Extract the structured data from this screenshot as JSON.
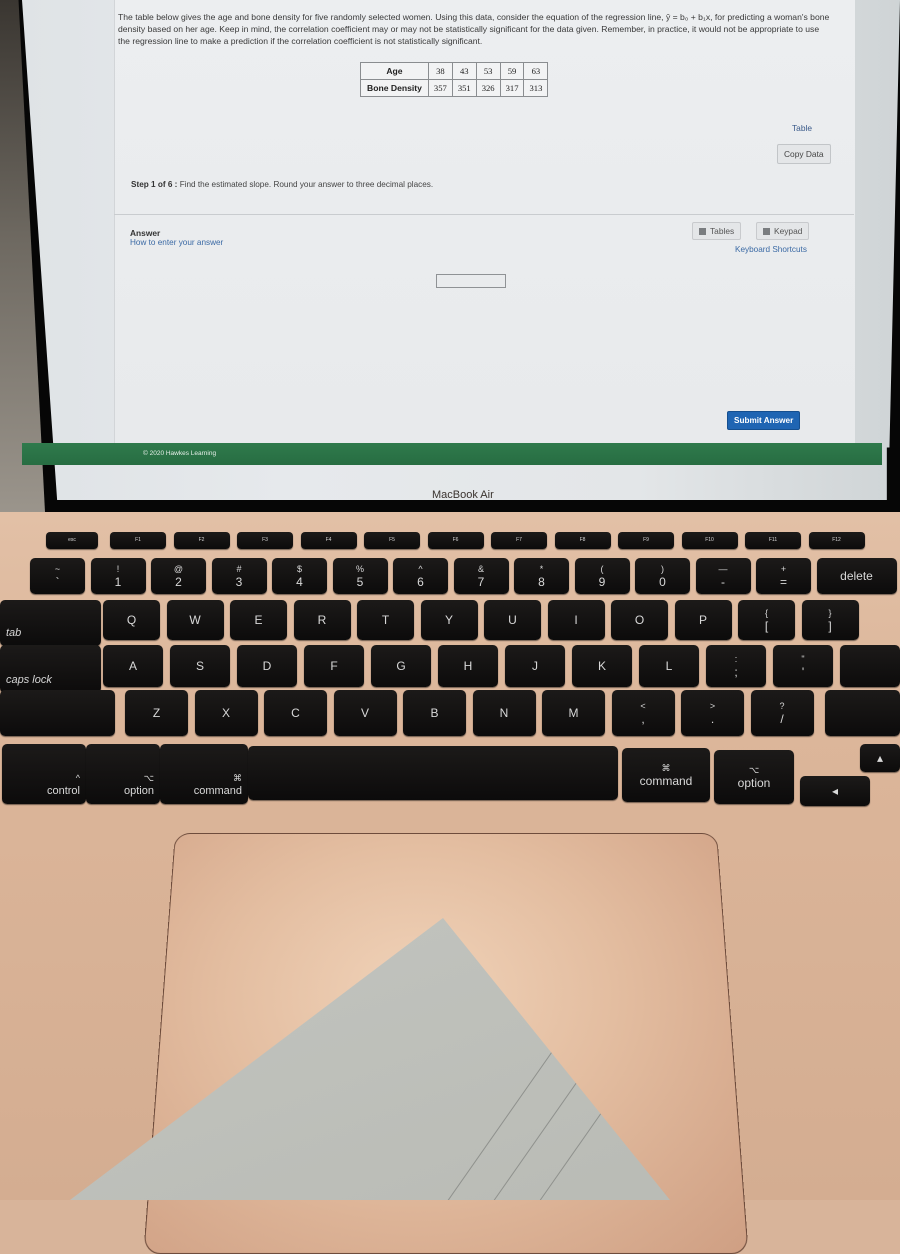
{
  "problem": {
    "intro": "The table below gives the age and bone density for five randomly selected women. Using this data, consider the equation of the regression line, ŷ = b₀ + b₁x, for predicting a woman's bone density based on her age. Keep in mind, the correlation coefficient may or may not be statistically significant for the data given. Remember, in practice, it would not be appropriate to use the regression line to make a prediction if the correlation coefficient is not statistically significant.",
    "table": {
      "row_labels": [
        "Age",
        "Bone Density"
      ],
      "age": [
        "38",
        "43",
        "53",
        "59",
        "63"
      ],
      "bone_density": [
        "357",
        "351",
        "326",
        "317",
        "313"
      ]
    },
    "table_link": "Table",
    "copy_data_label": "Copy Data",
    "step_label": "Step 1 of 6 :",
    "step_text": "Find the estimated slope. Round your answer to three decimal places."
  },
  "answer": {
    "label": "Answer",
    "help_link": "How to enter your answer",
    "input_value": "",
    "tables_label": "Tables",
    "keypad_label": "Keypad",
    "shortcuts_link": "Keyboard Shortcuts",
    "submit_label": "Submit Answer"
  },
  "footer": {
    "copyright": "© 2020 Hawkes Learning"
  },
  "device": {
    "brand": "MacBook Air"
  },
  "keyboard": {
    "fn_row": [
      "esc",
      "F1",
      "F2",
      "F3",
      "F4",
      "F5",
      "F6",
      "F7",
      "F8",
      "F9",
      "F10",
      "F11",
      "F12"
    ],
    "number_row": [
      [
        "~",
        "`"
      ],
      [
        "!",
        "1"
      ],
      [
        "@",
        "2"
      ],
      [
        "#",
        "3"
      ],
      [
        "$",
        "4"
      ],
      [
        "%",
        "5"
      ],
      [
        "^",
        "6"
      ],
      [
        "&",
        "7"
      ],
      [
        "*",
        "8"
      ],
      [
        "(",
        "9"
      ],
      [
        ")",
        "0"
      ],
      [
        "—",
        "-"
      ],
      [
        "+",
        "="
      ],
      [
        "",
        "delete"
      ]
    ],
    "top_row": [
      "tab",
      "Q",
      "W",
      "E",
      "R",
      "T",
      "Y",
      "U",
      "I",
      "O",
      "P",
      [
        "{",
        "["
      ],
      [
        "}",
        "]"
      ]
    ],
    "home_row": [
      "caps lock",
      "A",
      "S",
      "D",
      "F",
      "G",
      "H",
      "J",
      "K",
      "L",
      [
        ":",
        ";"
      ],
      [
        "\"",
        "'"
      ]
    ],
    "bottom_row": [
      "Z",
      "X",
      "C",
      "V",
      "B",
      "N",
      "M",
      [
        "<",
        ","
      ],
      [
        ">",
        "."
      ],
      [
        "?",
        "/"
      ]
    ],
    "modifier_row": {
      "control": "control",
      "control_sym": "^",
      "option": "option",
      "option_sym": "⌥",
      "command": "command",
      "command_sym": "⌘"
    }
  },
  "colors": {
    "footer_green": "#2f7a4c",
    "submit_blue": "#1f65b3",
    "link_blue": "#3b6aa5",
    "laptop_gold": "#dcb69a"
  }
}
